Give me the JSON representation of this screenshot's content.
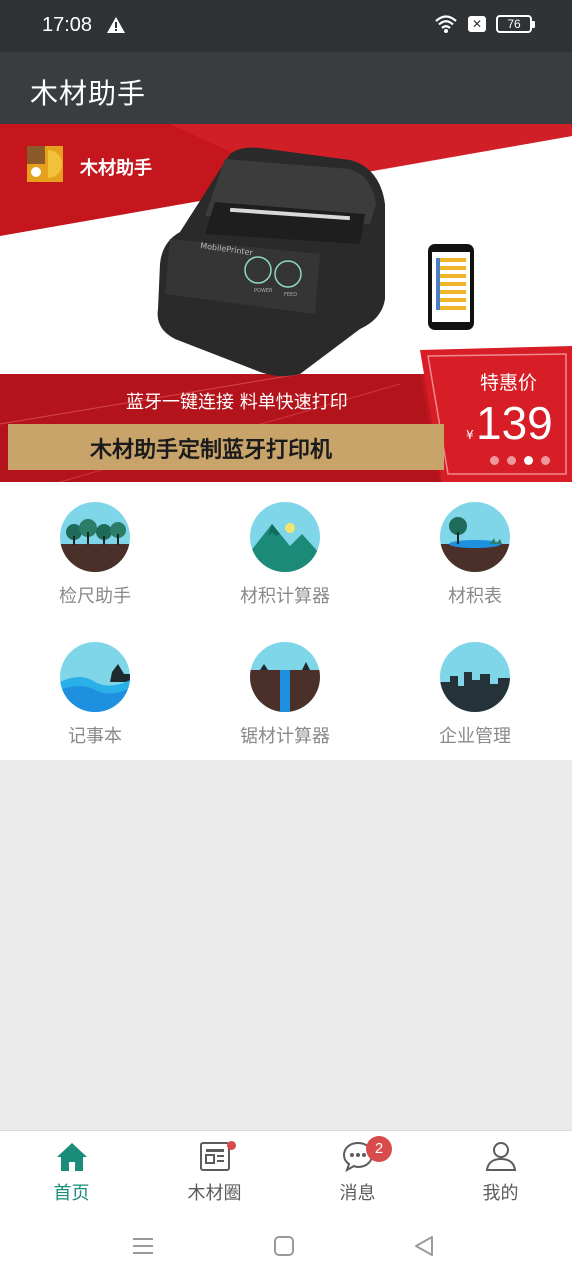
{
  "status_bar": {
    "time": "17:08",
    "battery": "76",
    "warning_icon": "warning-icon",
    "wifi_icon": "wifi-icon",
    "sim_icon": "no-sim-icon",
    "sim_glyph": "✕"
  },
  "app_bar": {
    "title": "木材助手"
  },
  "banner": {
    "logo_text": "木材助手",
    "subtitle": "蓝牙一键连接 料单快速打印",
    "title": "木材助手定制蓝牙打印机",
    "price_label": "特惠价",
    "currency": "¥",
    "price": "139",
    "printer_brand": "MobilePrinter",
    "printer_btn_1": "POWER",
    "printer_btn_2": "FEED",
    "slides": 4,
    "active_slide": 3,
    "accent_red": "#c4161c",
    "strip_color": "#c9a46a"
  },
  "grid": {
    "items": [
      {
        "label": "检尺助手",
        "icon": "forest-icon"
      },
      {
        "label": "材积计算器",
        "icon": "mountain-icon"
      },
      {
        "label": "材积表",
        "icon": "lake-icon"
      },
      {
        "label": "记事本",
        "icon": "waves-icon"
      },
      {
        "label": "锯材计算器",
        "icon": "waterfall-icon"
      },
      {
        "label": "企业管理",
        "icon": "city-icon"
      }
    ]
  },
  "bottom_nav": {
    "items": [
      {
        "label": "首页",
        "icon": "home-icon",
        "active": true
      },
      {
        "label": "木材圈",
        "icon": "news-icon",
        "badge_dot": true
      },
      {
        "label": "消息",
        "icon": "chat-icon",
        "badge": "2"
      },
      {
        "label": "我的",
        "icon": "user-icon"
      }
    ],
    "active_color": "#1a8c7a"
  }
}
